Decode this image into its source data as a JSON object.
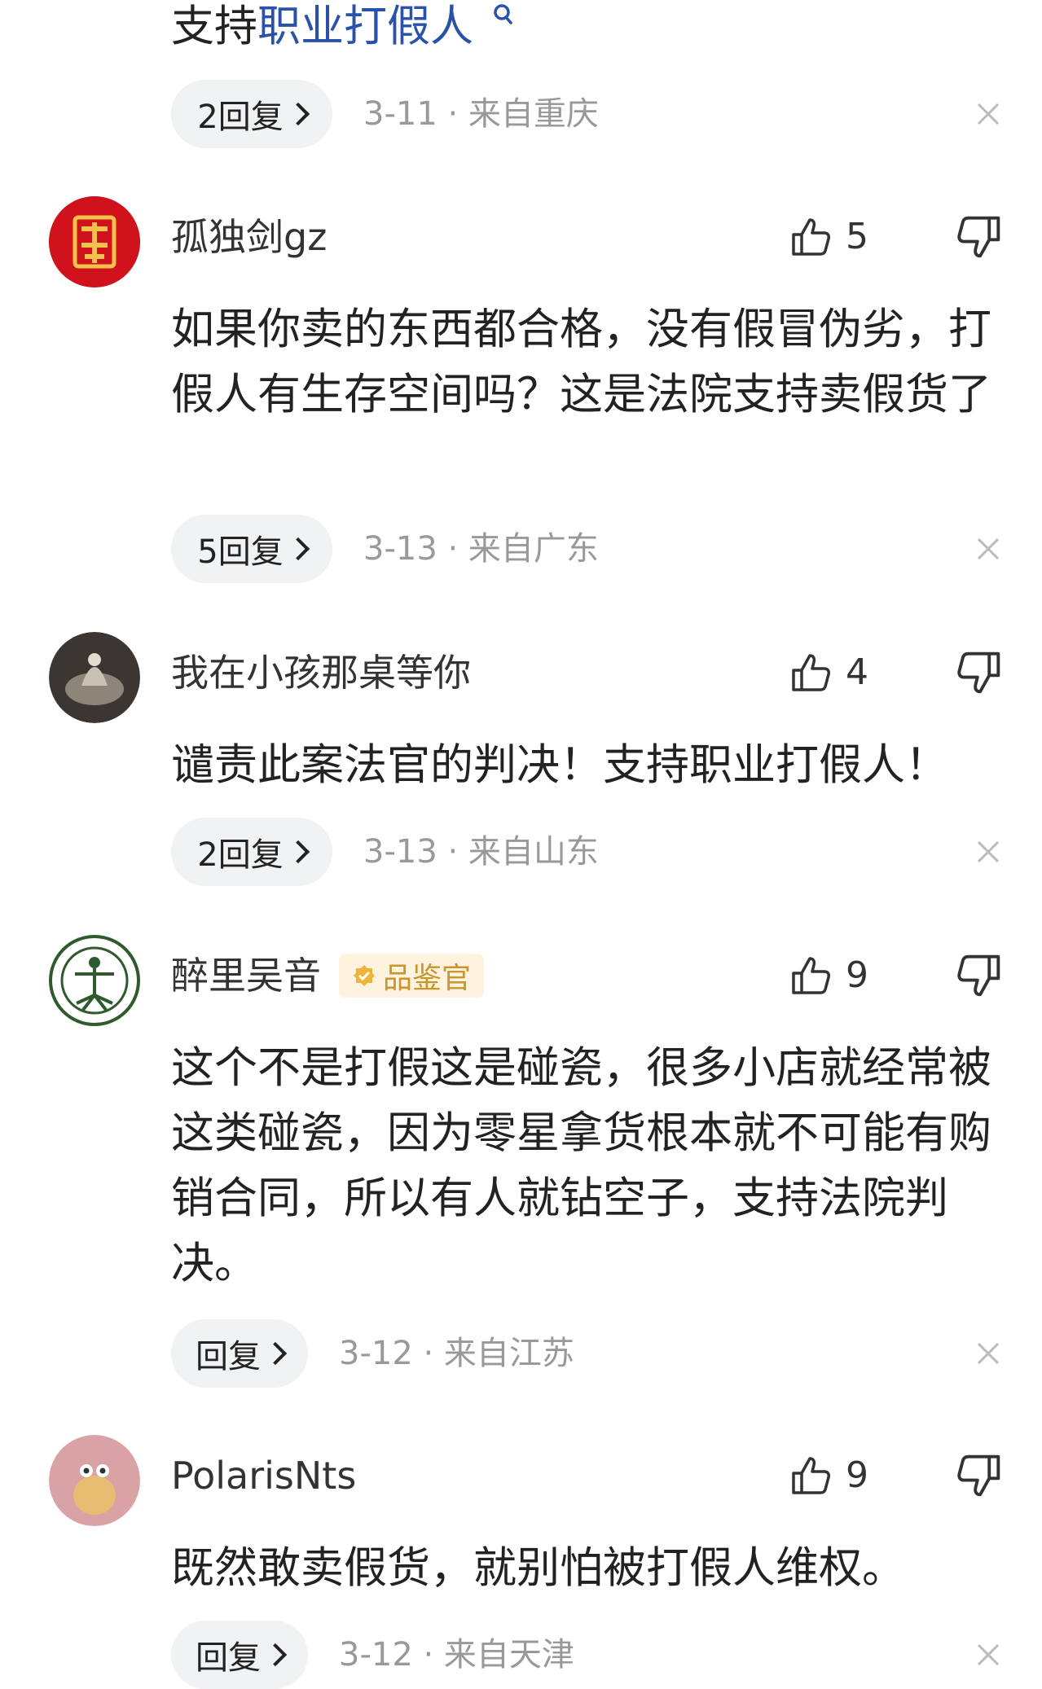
{
  "top": {
    "text_prefix": "支持",
    "text_keyword": "职业打假人",
    "reply_label": "2回复",
    "meta": "3-11 · 来自重庆"
  },
  "comments": [
    {
      "username": "孤独剑gz",
      "likes": "5",
      "text": "如果你卖的东西都合格，没有假冒伪劣，打假人有生存空间吗？这是法院支持卖假货了",
      "reply_label": "5回复",
      "meta": "3-13 · 来自广东"
    },
    {
      "username": "我在小孩那桌等你",
      "likes": "4",
      "text": "谴责此案法官的判决！支持职业打假人！",
      "reply_label": "2回复",
      "meta": "3-13 · 来自山东"
    },
    {
      "username": "醉里吴音",
      "badge": "品鉴官",
      "likes": "9",
      "text": "这个不是打假这是碰瓷，很多小店就经常被这类碰瓷，因为零星拿货根本就不可能有购销合同，所以有人就钻空子，支持法院判决。",
      "reply_label": "回复",
      "meta": "3-12 · 来自江苏"
    },
    {
      "username": "PolarisNts",
      "likes": "9",
      "text": "既然敢卖假货，就别怕被打假人维权。",
      "reply_label": "回复",
      "meta": "3-12 · 来自天津"
    }
  ],
  "colors": {
    "keyword": "#2a52a8",
    "meta": "#999999",
    "pill_bg": "#f1f2f4",
    "badge_bg": "#fdf3de",
    "badge_fg": "#c9952e"
  },
  "icons": [
    "search-icon",
    "thumbs-up-icon",
    "thumbs-down-icon",
    "close-icon",
    "chevron-right-icon",
    "verified-icon"
  ]
}
